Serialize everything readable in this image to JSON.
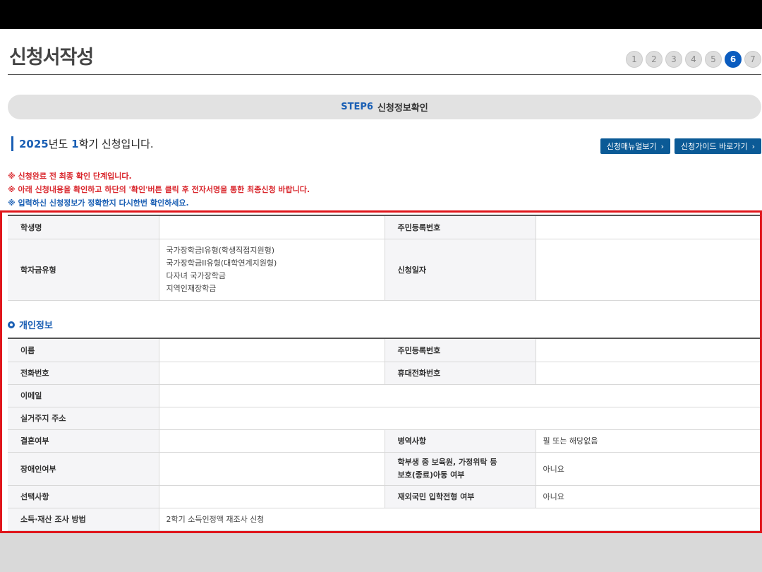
{
  "header": {
    "title": "신청서작성"
  },
  "steps": [
    "1",
    "2",
    "3",
    "4",
    "5",
    "6",
    "7"
  ],
  "active_step": "6",
  "banner": {
    "code": "STEP6",
    "title": "신청정보확인"
  },
  "semester": {
    "year": "2025",
    "year_suffix": "년도 ",
    "term": "1",
    "term_suffix": "학기 신청입니다."
  },
  "buttons": {
    "manual": "신청매뉴얼보기",
    "guide": "신청가이드 바로가기"
  },
  "notices": [
    "※ 신청완료 전 최종 확인 단계입니다.",
    "※ 아래 신청내용을 확인하고 하단의 '확인'버튼 클릭 후 전자서명을 통한 최종신청 바랍니다.",
    "※ 입력하신 신청정보가 정확한지 다시한번 확인하세요."
  ],
  "summary": {
    "student_name_label": "학생명",
    "student_name": "",
    "rrn_label": "주민등록번호",
    "rrn": "",
    "type_label": "학자금유형",
    "types": [
      "국가장학금I유형(학생직접지원형)",
      "국가장학금II유형(대학연계지원형)",
      "다자녀 국가장학금",
      "지역인재장학금"
    ],
    "date_label": "신청일자",
    "date": ""
  },
  "personal": {
    "section_title": "개인정보",
    "name_label": "이름",
    "name": "",
    "rrn_label": "주민등록번호",
    "rrn": "",
    "phone_label": "전화번호",
    "phone": "",
    "mobile_label": "휴대전화번호",
    "mobile": "",
    "email_label": "이메일",
    "email": "",
    "address_label": "실거주지 주소",
    "address": "",
    "marriage_label": "결혼여부",
    "marriage": "",
    "military_label": "병역사항",
    "military": "필 또는 해당없음",
    "disability_label": "장애인여부",
    "disability": "",
    "foster_label_1": "학부생 중 보육원, 가정위탁 등",
    "foster_label_2": "보호(종료)아동 여부",
    "foster": "아니요",
    "option_label": "선택사항",
    "option": "",
    "overseas_label": "재외국민 입학전형 여부",
    "overseas": "아니요",
    "income_label": "소득·재산 조사 방법",
    "income": "2학기 소득인정액 재조사 신청"
  }
}
